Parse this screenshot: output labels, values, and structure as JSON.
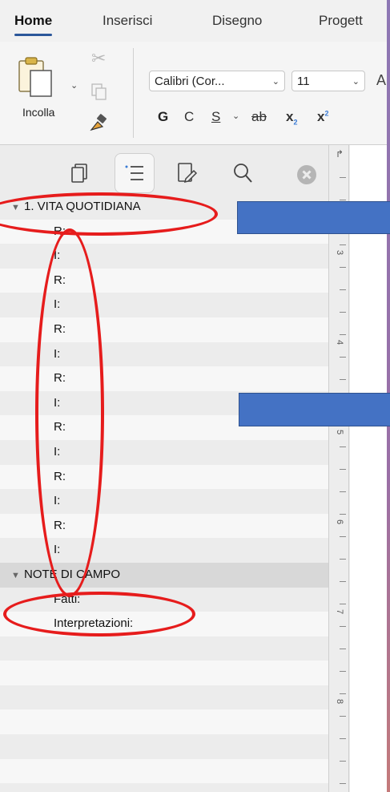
{
  "ribbon": {
    "tabs": [
      "Home",
      "Inserisci",
      "Disegno",
      "Progett"
    ],
    "paste_label": "Incolla",
    "font_name": "Calibri (Cor...",
    "font_size": "11",
    "format_buttons": [
      "G",
      "C",
      "S",
      "ab",
      "x",
      "x"
    ]
  },
  "nav": {
    "items": [
      {
        "text": "1. VITA QUOTIDIANA",
        "level": 0
      },
      {
        "text": "R:",
        "level": 1
      },
      {
        "text": "I:",
        "level": 1
      },
      {
        "text": "R:",
        "level": 1
      },
      {
        "text": "I:",
        "level": 1
      },
      {
        "text": "R:",
        "level": 1
      },
      {
        "text": "I:",
        "level": 1
      },
      {
        "text": "R:",
        "level": 1
      },
      {
        "text": "I:",
        "level": 1
      },
      {
        "text": "R:",
        "level": 1
      },
      {
        "text": "I:",
        "level": 1
      },
      {
        "text": "R:",
        "level": 1
      },
      {
        "text": "I:",
        "level": 1
      },
      {
        "text": "R:",
        "level": 1
      },
      {
        "text": "I:",
        "level": 1
      },
      {
        "text": "NOTE DI CAMPO",
        "level": 0
      },
      {
        "text": "Fatti:",
        "level": 2
      },
      {
        "text": "Interpretazioni:",
        "level": 2
      }
    ]
  },
  "ruler": {
    "numbers": [
      "3",
      "4",
      "5",
      "6",
      "7",
      "8"
    ]
  },
  "colors": {
    "annotation_red": "#e61c1c",
    "annotation_blue": "#4472c4",
    "accent": "#2b579a"
  }
}
